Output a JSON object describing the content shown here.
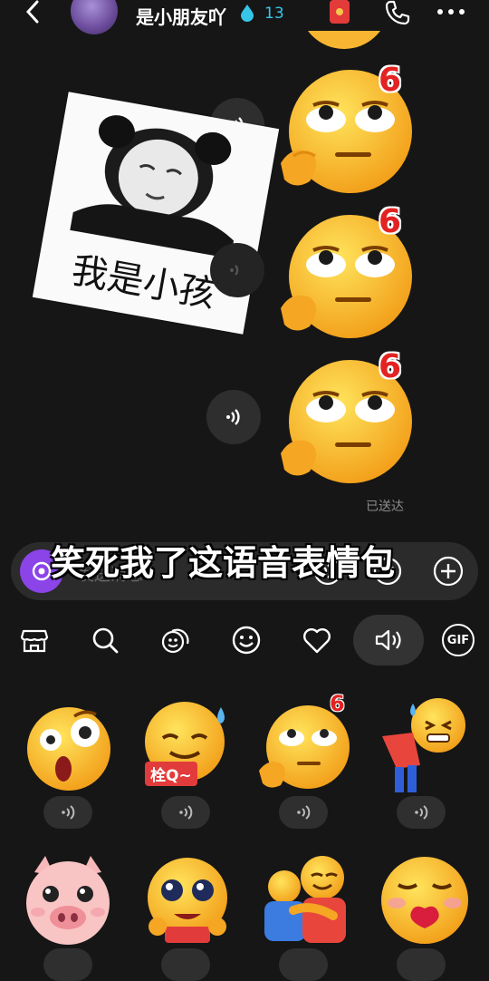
{
  "header": {
    "back_icon": "chevron-left-icon",
    "contact_name": "是小朋友吖",
    "streak_count": "13",
    "streak_icon": "flame-drop-icon",
    "streak_color": "#35c6e8",
    "red_packet_icon": "red-packet-icon",
    "call_icon": "phone-icon",
    "more_icon": "more-dots-icon"
  },
  "chat": {
    "meme_caption": "我是小孩",
    "badge": "6",
    "delivered_status": "已送达"
  },
  "input": {
    "placeholder": "发送消息",
    "overlay_caption": "笑死我了这语音表情包"
  },
  "tabs": {
    "items": [
      "store-icon",
      "search-icon",
      "sticker-pack-icon",
      "smiley-icon",
      "heart-icon",
      "voice-sticker-icon",
      "gif-icon"
    ],
    "gif_label": "GIF",
    "selected": "voice-sticker-icon"
  },
  "stickers": {
    "row1": [
      {
        "name": "surprised-face",
        "label": ""
      },
      {
        "name": "shy-sweat-face",
        "label": "栓Q~"
      },
      {
        "name": "eye-roll-six-face",
        "label": "",
        "badge": "6"
      },
      {
        "name": "bowing-sweat-face",
        "label": ""
      }
    ],
    "row2": [
      {
        "name": "pig-face",
        "label": ""
      },
      {
        "name": "pleading-face",
        "label": ""
      },
      {
        "name": "hug-faces",
        "label": ""
      },
      {
        "name": "kiss-face",
        "label": ""
      }
    ]
  }
}
